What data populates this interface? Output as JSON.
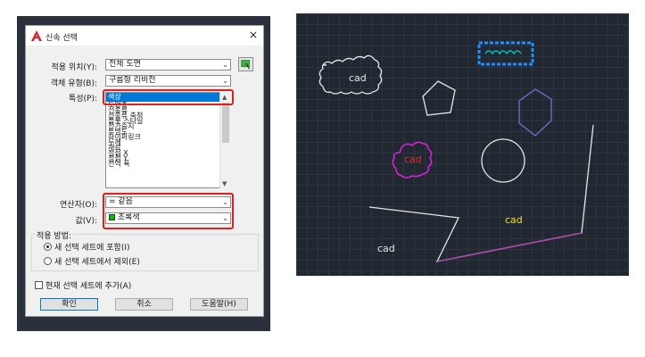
{
  "dialog": {
    "title": "신속 선택",
    "close_glyph": "×",
    "apply_to_label": "적용 위치(Y):",
    "apply_to_value": "전체 도면",
    "object_type_label": "객체 유형(B):",
    "object_type_value": "구름형 리비전",
    "properties_label": "특성(P):",
    "properties_items": [
      "색상",
      "도면층",
      "선종류",
      "선종류 축척",
      "플롯 스타일",
      "선가중치",
      "투명도",
      "하이퍼링크",
      "두께",
      "재료",
      "정점 X",
      "정점 Y",
      "전역 폭"
    ],
    "operator_label": "연산자(O):",
    "operator_value": "= 같음",
    "value_label": "값(V):",
    "value_value": "초록색",
    "value_swatch_color": "#00c000",
    "how_to_apply_title": "적용 방법:",
    "radio_include": "새 선택 세트에 포함(I)",
    "radio_exclude": "새 선택 세트에서 제외(E)",
    "append_checkbox": "현재 선택 세트에 추가(A)",
    "ok_label": "확인",
    "cancel_label": "취소",
    "help_label": "도움말(H)"
  },
  "drawing": {
    "cloud1_text": "cad",
    "cloud2_text": "cad",
    "text_yellow": "cad",
    "text_white": "cad"
  },
  "colors": {
    "highlight_red": "#e0201e",
    "selection_blue": "#1e90ff",
    "cloud_magenta": "#e020e0",
    "text_red": "#e03030",
    "text_yellow": "#f0e020",
    "polygon_purple": "#7070d0"
  }
}
